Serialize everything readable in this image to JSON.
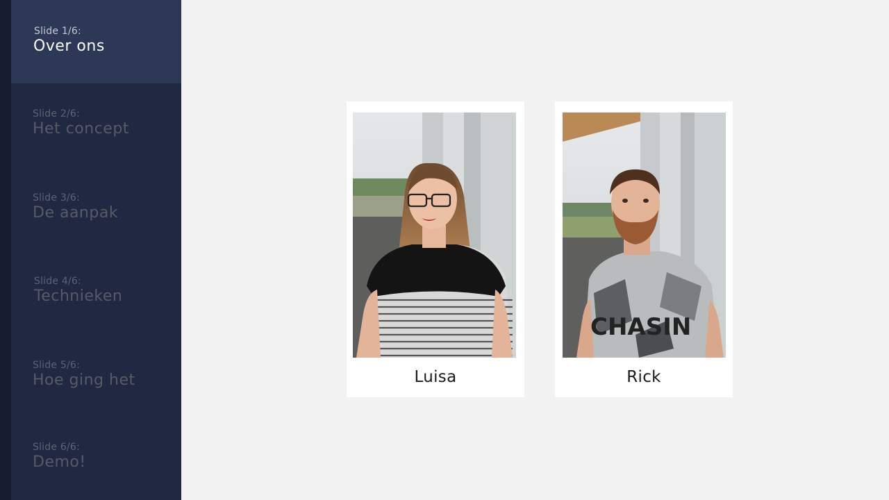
{
  "sidebar": {
    "slides": [
      {
        "number": "Slide 1/6:",
        "title": "Over ons"
      },
      {
        "number": "Slide 2/6:",
        "title": "Het concept"
      },
      {
        "number": "Slide 3/6:",
        "title": "De aanpak"
      },
      {
        "number": "Slide 4/6:",
        "title": "Technieken"
      },
      {
        "number": "Slide 5/6:",
        "title": "Hoe ging het"
      },
      {
        "number": "Slide 6/6:",
        "title": "Demo!"
      }
    ],
    "active_index": 0
  },
  "team": {
    "members": [
      {
        "name": "Luisa"
      },
      {
        "name": "Rick",
        "shirt_text": "CHASIN"
      }
    ]
  },
  "colors": {
    "sidebar_bg": "#212842",
    "sidebar_active_bg": "#2d3756",
    "stage_bg": "#f2f2f2",
    "card_bg": "#ffffff"
  }
}
